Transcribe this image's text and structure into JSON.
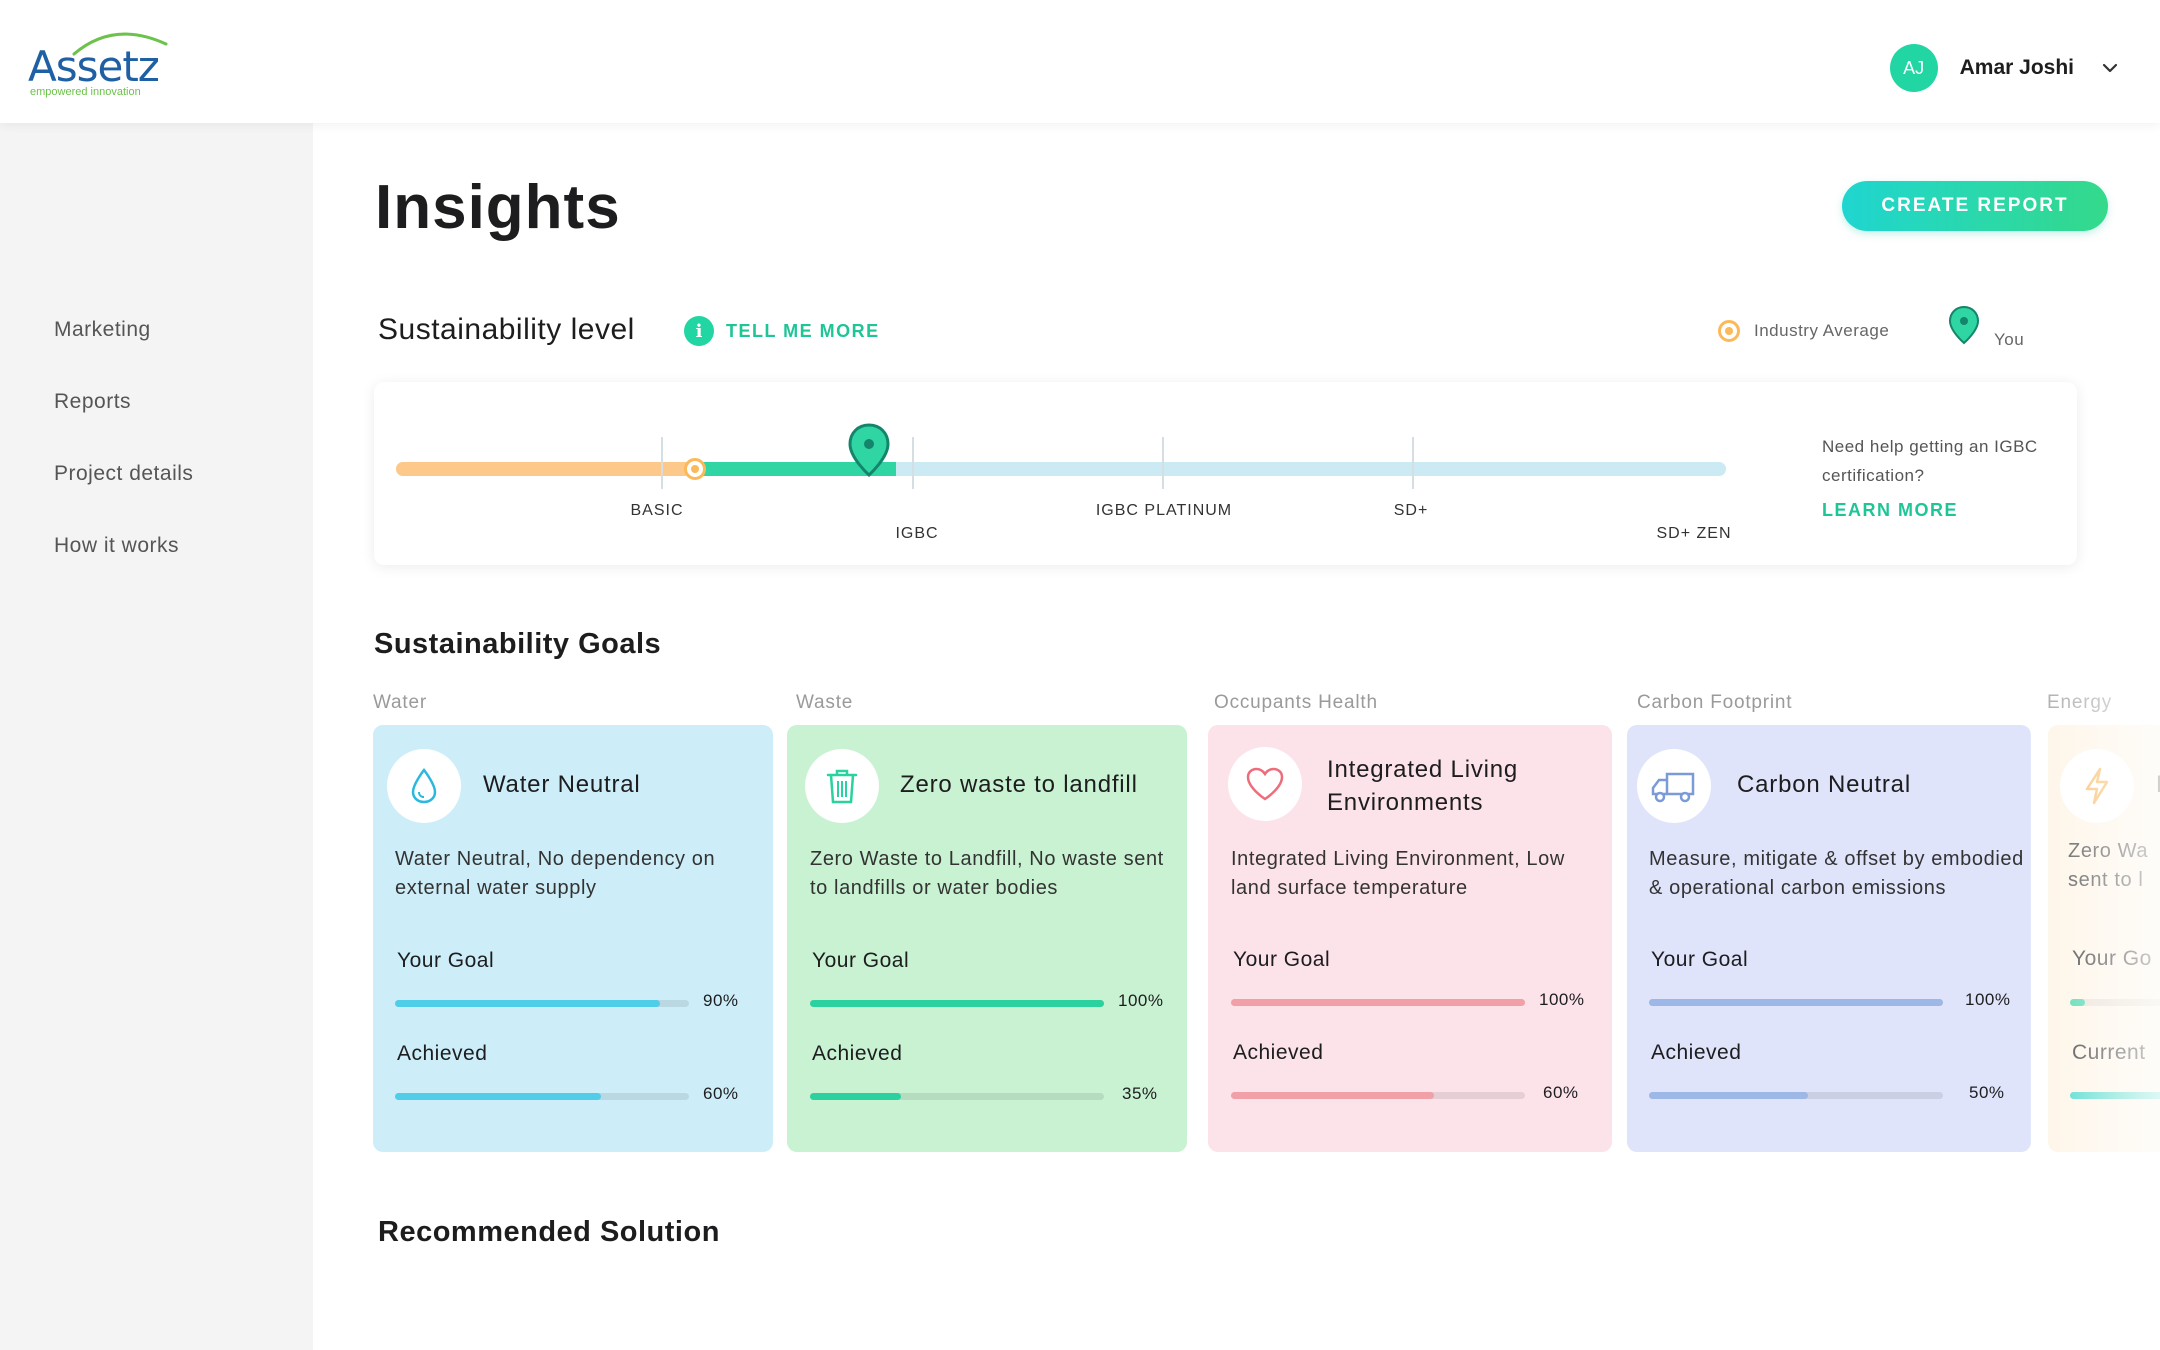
{
  "header": {
    "logo_text": "Assetz",
    "logo_tagline": "empowered innovation",
    "user_initials": "AJ",
    "user_name": "Amar Joshi"
  },
  "sidebar": {
    "items": [
      {
        "label": "Marketing"
      },
      {
        "label": "Reports"
      },
      {
        "label": "Project details"
      },
      {
        "label": "How it works"
      }
    ]
  },
  "page": {
    "title": "Insights",
    "create_report_label": "CREATE REPORT"
  },
  "sustainability_level": {
    "title": "Sustainability level",
    "tell_me_more": "TELL ME MORE",
    "legend_average": "Industry Average",
    "legend_you": "You",
    "levels": [
      "BASIC",
      "IGBC",
      "IGBC PLATINUM",
      "SD+",
      "SD+ ZEN"
    ],
    "industry_average_level": "BASIC",
    "your_level": "IGBC",
    "help_text": "Need help getting an IGBC certification?",
    "learn_more": "LEARN MORE",
    "colors": {
      "average": "#fbb95a",
      "you": "#2fd6a3",
      "track": "#cbeaf3"
    }
  },
  "goals": {
    "title": "Sustainability Goals",
    "cards": [
      {
        "category": "Water",
        "icon": "water-drop-icon",
        "title": "Water Neutral",
        "desc": "Water Neutral, No dependency on external water supply",
        "goal_label": "Your Goal",
        "goal_pct": 90,
        "goal_text": "90%",
        "achieved_label": "Achieved",
        "achieved_pct": 60,
        "achieved_text": "60%",
        "bg": "#cdeef8",
        "bar": "#4fcde9"
      },
      {
        "category": "Waste",
        "icon": "trash-icon",
        "title": "Zero waste to landfill",
        "desc": "Zero Waste to Landfill, No waste sent to landfills or water bodies",
        "goal_label": "Your Goal",
        "goal_pct": 100,
        "goal_text": "100%",
        "achieved_label": "Achieved",
        "achieved_pct": 35,
        "achieved_text": "35%",
        "bg": "#c8f2d2",
        "bar": "#2bd19e"
      },
      {
        "category": "Occupants Health",
        "icon": "heart-icon",
        "title": "Integrated Living Environments",
        "desc": "Integrated Living Environment, Low land surface temperature",
        "goal_label": "Your Goal",
        "goal_pct": 100,
        "goal_text": "100%",
        "achieved_label": "Achieved",
        "achieved_pct": 60,
        "achieved_text": "60%",
        "bg": "#fce3ea",
        "bar": "#f1a0a8"
      },
      {
        "category": "Carbon Footprint",
        "icon": "truck-icon",
        "title": "Carbon Neutral",
        "desc": "Measure, mitigate & offset by embodied & operational carbon emissions",
        "goal_label": "Your Goal",
        "goal_pct": 100,
        "goal_text": "100%",
        "achieved_label": "Achieved",
        "achieved_pct": 50,
        "achieved_text": "50%",
        "bg": "#dfe4fb",
        "bar": "#9db7e6"
      }
    ],
    "partial_card": {
      "category": "Energy",
      "icon": "lightning-icon",
      "title_fragment": "R",
      "desc_fragment": "Zero Wa sent to l",
      "goal_fragment": "Your Go",
      "current_fragment": "Current"
    }
  },
  "recommended": {
    "title": "Recommended Solution"
  }
}
